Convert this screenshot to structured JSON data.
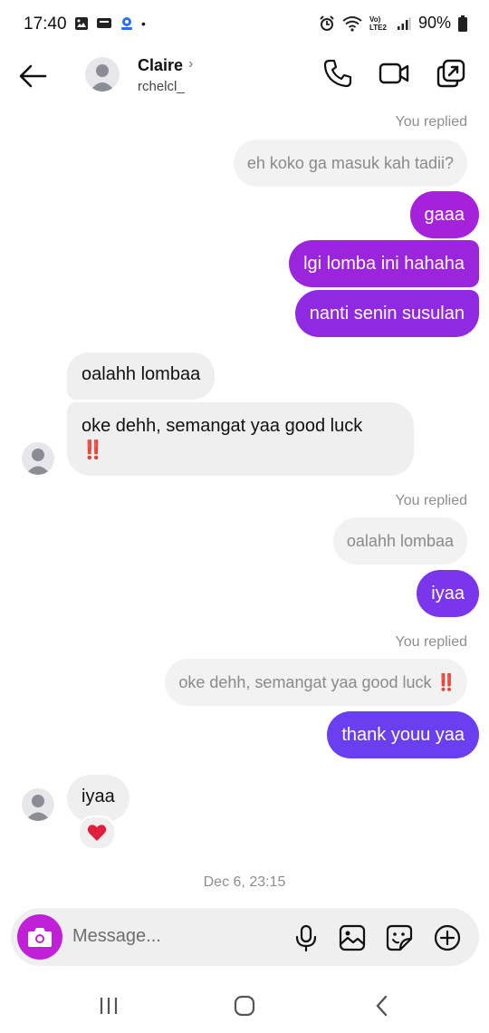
{
  "status_bar": {
    "time": "17:40",
    "battery": "90%",
    "network_label": "Vo) LTE2"
  },
  "contact": {
    "name": "Claire",
    "username": "rchelcl_"
  },
  "icons": {
    "back": "arrow-left-icon",
    "phone": "phone-icon",
    "video": "video-camera-icon",
    "share": "share-screen-icon",
    "camera": "camera-icon",
    "mic": "microphone-icon",
    "gallery": "image-icon",
    "sticker": "sticker-icon",
    "add": "plus-circle-icon"
  },
  "messages": {
    "reply_label_1": "You replied",
    "quoted_1": "eh koko ga masuk kah tadii?",
    "sent_1": "gaaa",
    "sent_2": "lgi lomba ini hahaha",
    "sent_3": "nanti senin susulan",
    "recv_1": "oalahh lombaa",
    "recv_2": "oke dehh, semangat yaa good luck",
    "recv_2_emoji": "‼️",
    "reply_label_2": "You replied",
    "quoted_2": "oalahh lombaa",
    "sent_4": "iyaa",
    "reply_label_3": "You replied",
    "quoted_3": "oke dehh, semangat yaa good luck",
    "quoted_3_emoji": "‼️",
    "sent_5": "thank youu yaa",
    "recv_3": "iyaa",
    "reaction": "❤️"
  },
  "timestamp": "Dec 6, 23:15",
  "composer": {
    "placeholder": "Message..."
  },
  "colors": {
    "sent_magenta": "#a521db",
    "sent_purple_mid": "#8a2ee6",
    "sent_violet": "#6a3ff0",
    "received_bg": "#efefef",
    "camera_button": "#c021d6"
  }
}
